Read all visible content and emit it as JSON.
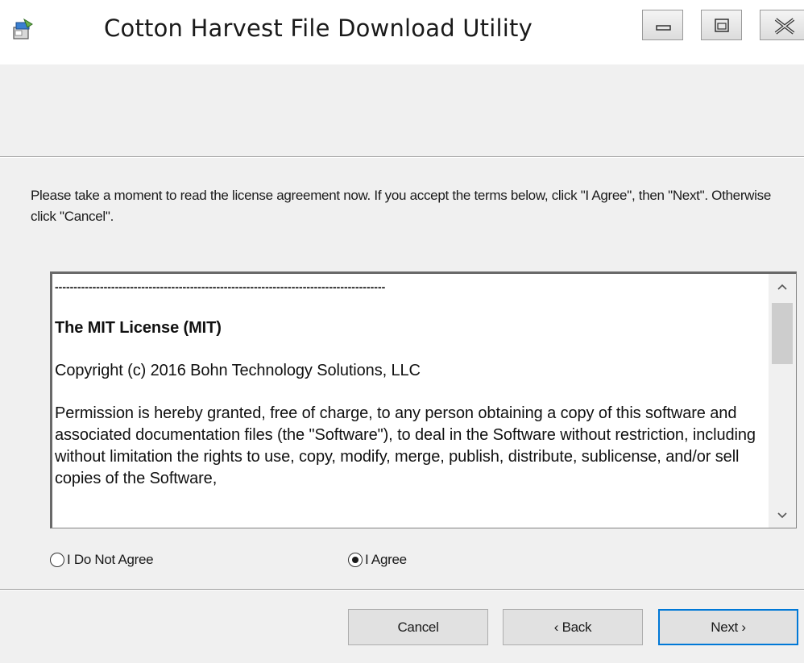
{
  "window": {
    "title": "Cotton Harvest File Download Utility",
    "icon": "installer-icon",
    "controls": [
      "minimize-icon",
      "maximize-icon",
      "close-icon"
    ]
  },
  "instructions": "Please take a moment to read the license agreement now. If you accept the terms below, click \"I Agree\", then \"Next\". Otherwise click \"Cancel\".",
  "license": {
    "separator": "----------------------------------------------------------------------------------------",
    "title": "The MIT License (MIT)",
    "copyright": "Copyright (c) 2016 Bohn Technology Solutions, LLC",
    "permission": "Permission is hereby granted, free of charge, to any person obtaining a copy of this software and associated documentation files (the \"Software\"), to deal in the Software without restriction, including without limitation the rights to use, copy, modify, merge, publish, distribute, sublicense, and/or sell copies of the Software,"
  },
  "radios": {
    "disagree_label": "I Do Not Agree",
    "agree_label": "I Agree",
    "selected": "agree"
  },
  "buttons": {
    "cancel": "Cancel",
    "back": "‹ Back",
    "next": "Next ›"
  },
  "colors": {
    "accent": "#0078d7",
    "background": "#f0f0f0"
  }
}
